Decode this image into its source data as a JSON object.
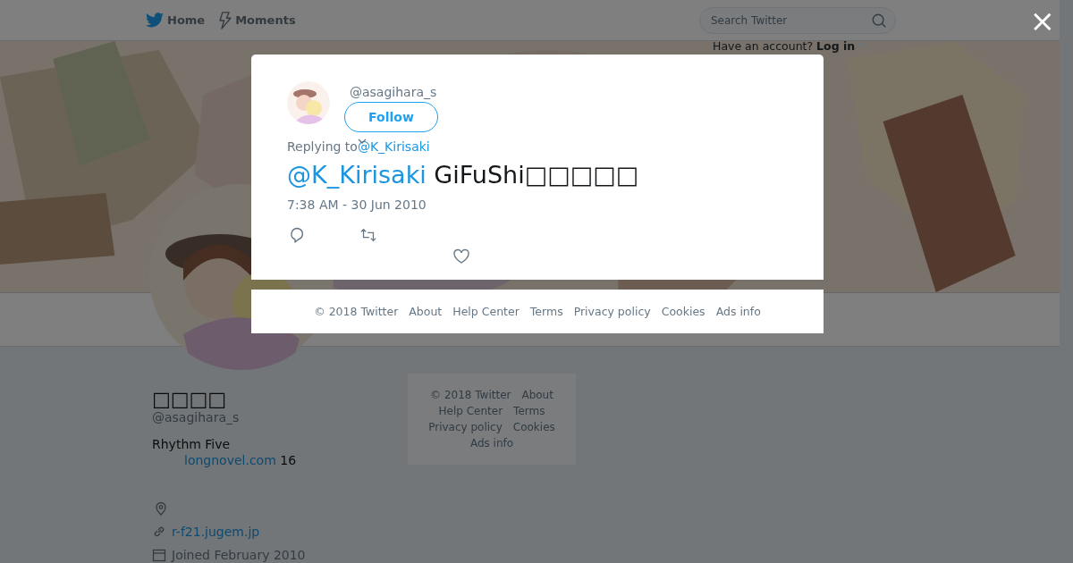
{
  "nav": {
    "items": [
      {
        "label": "Home",
        "kind": "bird"
      },
      {
        "label": "Moments",
        "kind": "bolt"
      }
    ],
    "search": {
      "placeholder": "Search Twitter"
    },
    "login_prompt": "Have an account?",
    "login_label": "Log in"
  },
  "profile": {
    "name": "□□□□",
    "handle": "@asagihara_s",
    "bio": "Rhythm Five",
    "bio_link": "longnovel.com",
    "bio_suffix": "16",
    "website": "r-f21.jugem.jp",
    "joined": "Joined February 2010"
  },
  "side_footer": [
    "© 2018 Twitter",
    "About",
    "Help Center",
    "Terms",
    "Privacy policy",
    "Cookies",
    "Ads info"
  ],
  "tweet": {
    "handle": "@asagihara_s",
    "follow_label": "Follow",
    "replying_label": "Replying to",
    "reply_to": "@K_Kirisaki",
    "mention": "@K_Kirisaki",
    "text": "GiFuShi□□□□□",
    "time": "7:38 AM - 30 Jun 2010",
    "actions": [
      {
        "kind": "reply"
      },
      {
        "kind": "retweet"
      },
      {
        "kind": "like"
      }
    ]
  },
  "modal_footer": [
    "© 2018 Twitter",
    "About",
    "Help Center",
    "Terms",
    "Privacy policy",
    "Cookies",
    "Ads info"
  ],
  "close_label": "×"
}
